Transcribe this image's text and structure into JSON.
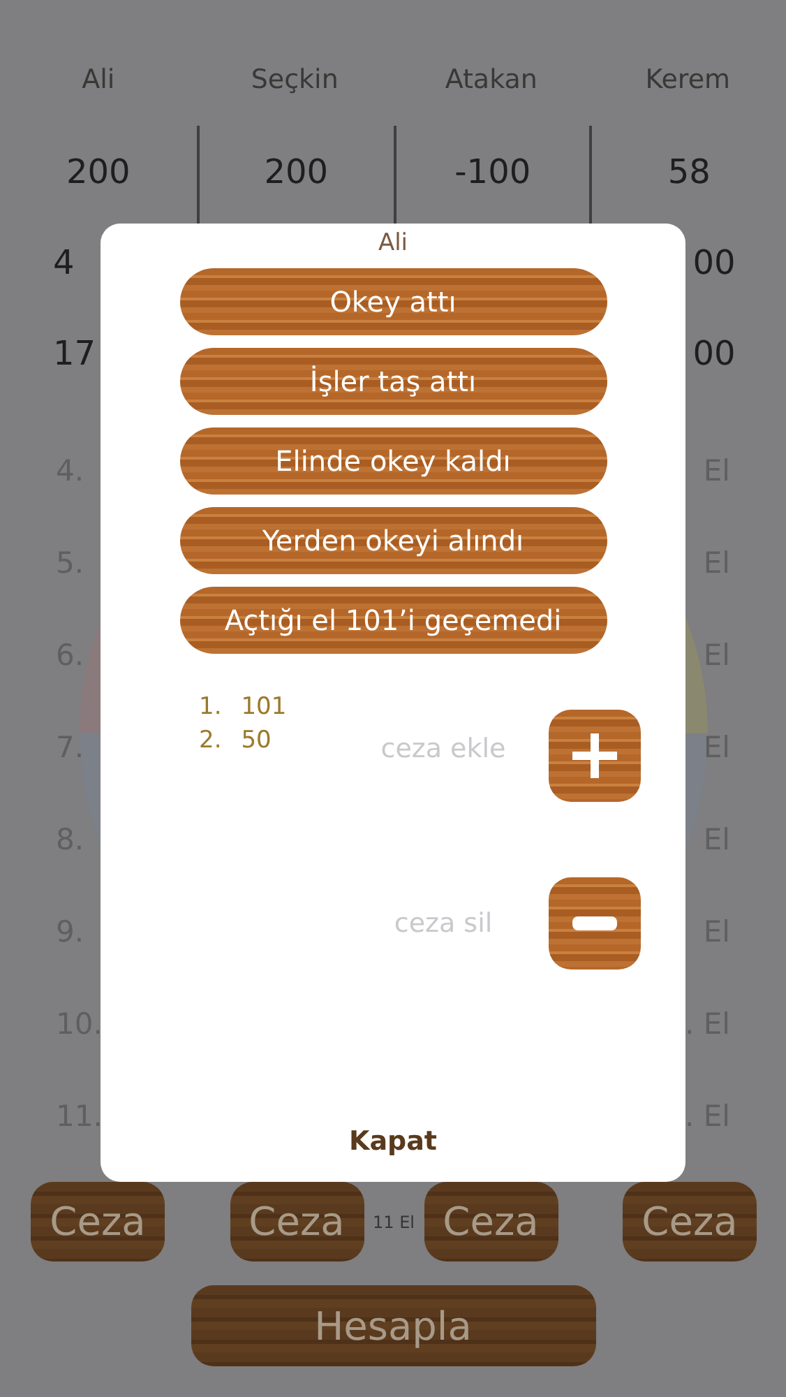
{
  "columns": [
    {
      "name": "Ali",
      "cells": [
        "200",
        "4",
        "17"
      ]
    },
    {
      "name": "Seçkin",
      "cells": [
        "200"
      ]
    },
    {
      "name": "Atakan",
      "cells": [
        "-100"
      ]
    },
    {
      "name": "Kerem",
      "cells": [
        "58",
        "00",
        "00"
      ]
    }
  ],
  "rounds": [
    {
      "number": "4.",
      "suffix": "El"
    },
    {
      "number": "5.",
      "suffix": "El"
    },
    {
      "number": "6.",
      "suffix": "El"
    },
    {
      "number": "7.",
      "suffix": "El"
    },
    {
      "number": "8.",
      "suffix": "El"
    },
    {
      "number": "9.",
      "suffix": "El"
    },
    {
      "number": "10.",
      "suffix": ". El"
    },
    {
      "number": "11.",
      "suffix": ". El"
    }
  ],
  "penalty_buttons": [
    "Ceza",
    "Ceza",
    "Ceza",
    "Ceza"
  ],
  "round_count": "11 El",
  "calculate_button": "Hesapla",
  "dialog": {
    "title": "Ali",
    "actions": [
      "Okey attı",
      "İşler taş attı",
      "Elinde okey kaldı",
      "Yerden okeyi alındı",
      "Açtığı el 101’i geçemedi"
    ],
    "penalties": [
      {
        "index": "1.",
        "value": "101"
      },
      {
        "index": "2.",
        "value": "50"
      }
    ],
    "add_field": {
      "placeholder": "ceza ekle"
    },
    "remove_field": {
      "placeholder": "ceza sil"
    },
    "close_button": "Kapat"
  }
}
